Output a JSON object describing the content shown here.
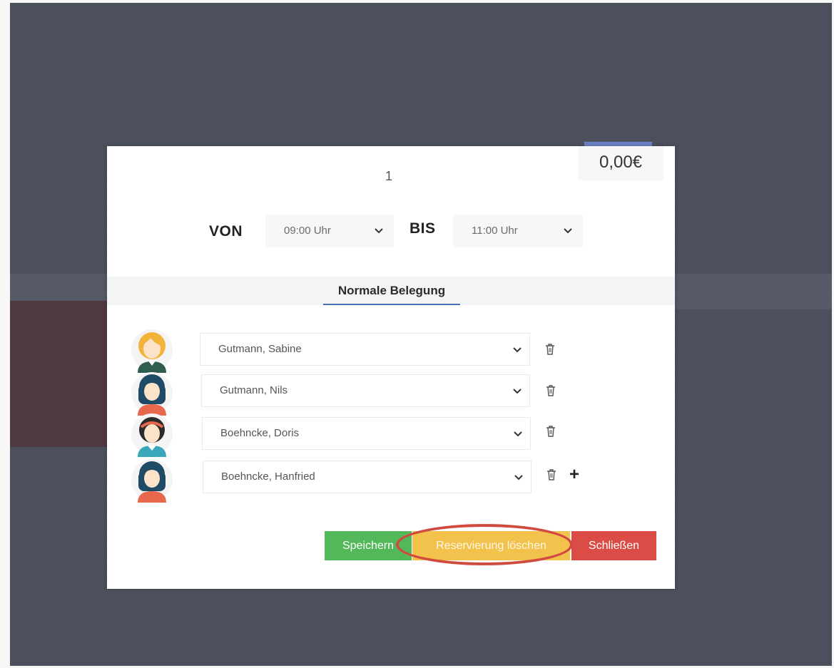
{
  "reservation": {
    "price": "0,00€",
    "room_number": "1",
    "from_label": "VON",
    "from_value": "09:00 Uhr",
    "to_label": "BIS",
    "to_value": "11:00 Uhr"
  },
  "tab": {
    "label": "Normale Belegung"
  },
  "guests": [
    {
      "name": "Gutmann, Sabine",
      "avatar": "female-blonde-avatar"
    },
    {
      "name": "Gutmann, Nils",
      "avatar": "female-dark-hair-avatar"
    },
    {
      "name": "Boehncke, Doris",
      "avatar": "female-headband-avatar"
    },
    {
      "name": "Boehncke, Hanfried",
      "avatar": "female-dark-hair-avatar"
    }
  ],
  "buttons": {
    "save": "Speichern",
    "delete": "Reservierung löschen",
    "close": "Schließen",
    "add": "+"
  },
  "colors": {
    "save": "#52b85a",
    "delete": "#f2c24c",
    "close": "#dc4c46",
    "tab_underline": "#4a6fb5",
    "highlight_ring": "#d14a3f"
  }
}
